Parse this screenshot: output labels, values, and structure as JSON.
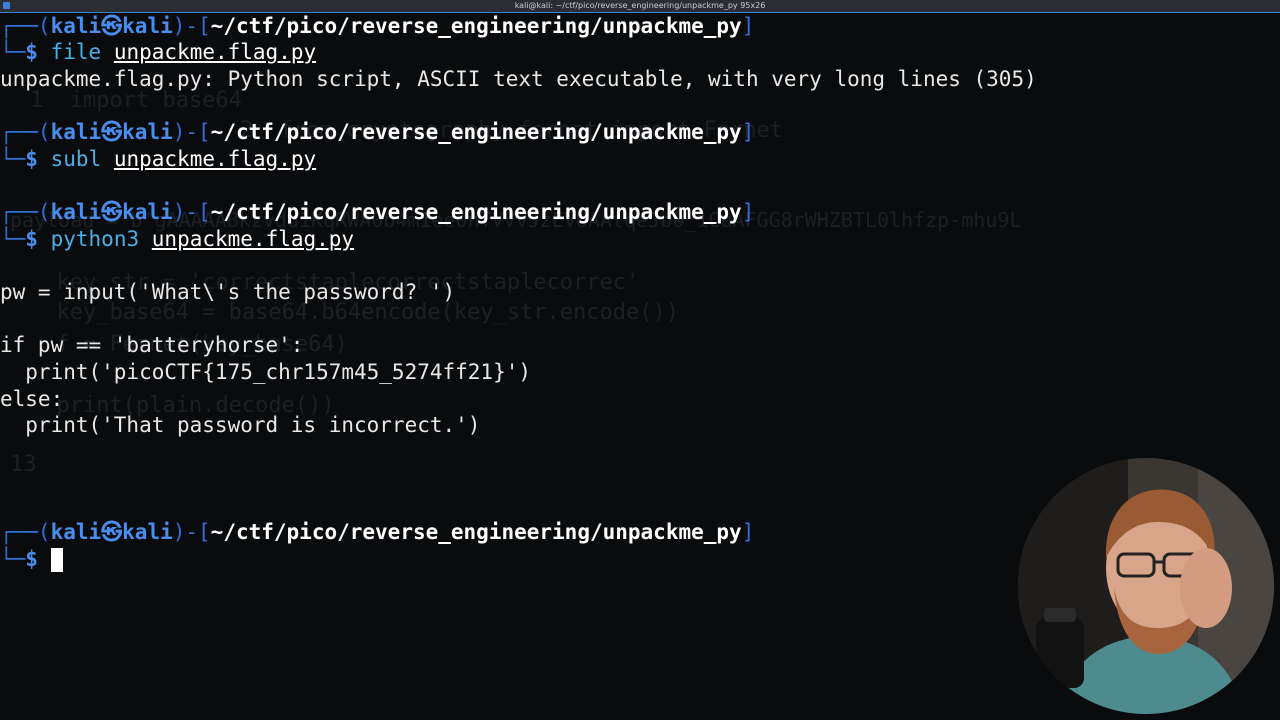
{
  "window": {
    "title": "kali@kali: ~/ctf/pico/reverse_engineering/unpackme_py 95x26"
  },
  "prompt": {
    "user": "kali",
    "host": "kali",
    "path": "~/ctf/pico/reverse_engineering/unpackme_py",
    "symbol": "$"
  },
  "blocks": [
    {
      "cmd": "file",
      "arg": "unpackme.flag.py",
      "output": "unpackme.flag.py: Python script, ASCII text executable, with very long lines (305)"
    },
    {
      "cmd": "subl",
      "arg": "unpackme.flag.py"
    },
    {
      "cmd": "python3",
      "arg": "unpackme.flag.py"
    }
  ],
  "code_lines": [
    "pw = input('What\\'s the password? ')",
    "",
    "if pw == 'batteryhorse':",
    "  print('picoCTF{175_chr157m45_5274ff21}')",
    "else:",
    "  print('That password is incorrect.')"
  ],
  "ghost_lines": [
    "1  import base64",
    "2  from cryptography.fernet import Fernet",
    "payload = b'gAAAAABkzvdd1KqRWA0b4m1ee0nTVVvJzEVUAAtqeJb0_1CuAFGG8rWHZBTL0lhfzp-mhu9L",
    "  key_str = 'correctstaplecorrectstaplecorrec'",
    "  key_base64 = base64.b64encode(key_str.encode())",
    "  f = Fernet(key_base64)",
    "  print(plain.decode())",
    "13"
  ]
}
